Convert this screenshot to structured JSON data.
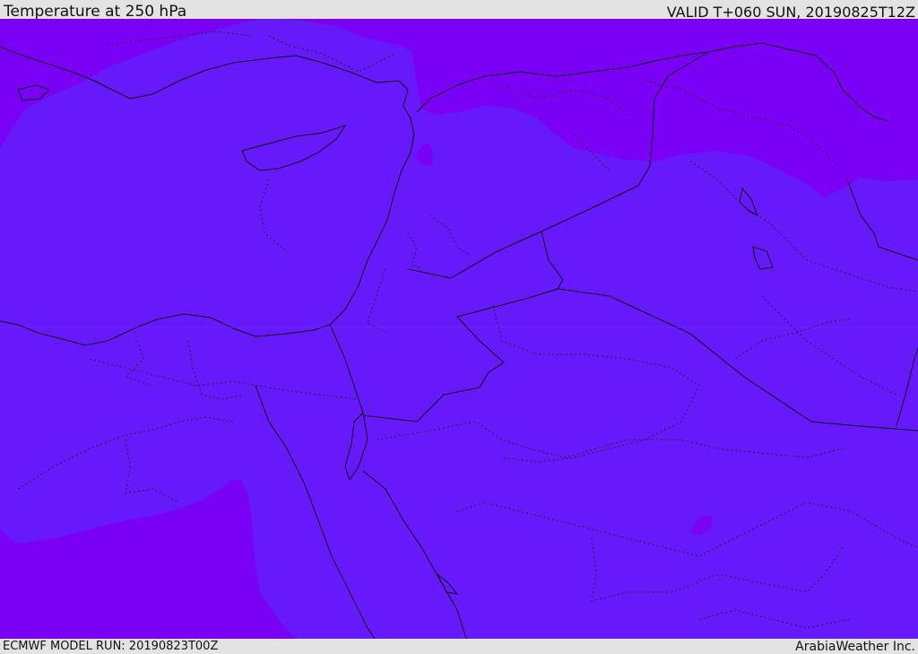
{
  "header": {
    "title": "Temperature at 250 hPa",
    "valid": "VALID T+060 SUN, 20190825T12Z"
  },
  "footer": {
    "run": "ECMWF MODEL RUN: 20190823T00Z",
    "credit": "ArabiaWeather Inc."
  },
  "colors": {
    "cold_band": "#7a00f6",
    "warm_band": "#6619fb",
    "border_line": "#111111",
    "page_background": "#e3e3e3"
  }
}
